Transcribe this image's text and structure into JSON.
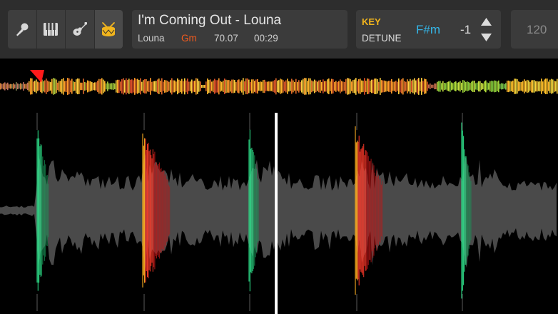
{
  "stem_buttons": [
    {
      "name": "vocals-stem-button",
      "icon": "microphone-icon",
      "active": false
    },
    {
      "name": "keys-stem-button",
      "icon": "piano-keys-icon",
      "active": false
    },
    {
      "name": "guitar-stem-button",
      "icon": "guitar-icon",
      "active": false
    },
    {
      "name": "drums-stem-button",
      "icon": "drum-icon",
      "active": true
    }
  ],
  "track": {
    "title": "I'm Coming Out - Louna",
    "artist": "Louna",
    "key": "Gm",
    "bpm": "70.07",
    "time": "00:29"
  },
  "key_panel": {
    "key_label": "KEY",
    "detune_label": "DETUNE",
    "key_value": "F#m",
    "detune_value": "-1"
  },
  "tempo": {
    "bpm": "120"
  },
  "colors": {
    "panel_bg": "#3b3b3b",
    "topbar_bg": "#2d2d2d",
    "active_icon": "#f2b51d",
    "key_label": "#f2b51d",
    "track_key": "#f05a1e",
    "key_value": "#34b6e8",
    "waveform_gray": "#4a4a4a",
    "playhead": "#ffffff"
  },
  "waveform": {
    "playhead_position": 0.496,
    "overview_position": 0.073
  }
}
